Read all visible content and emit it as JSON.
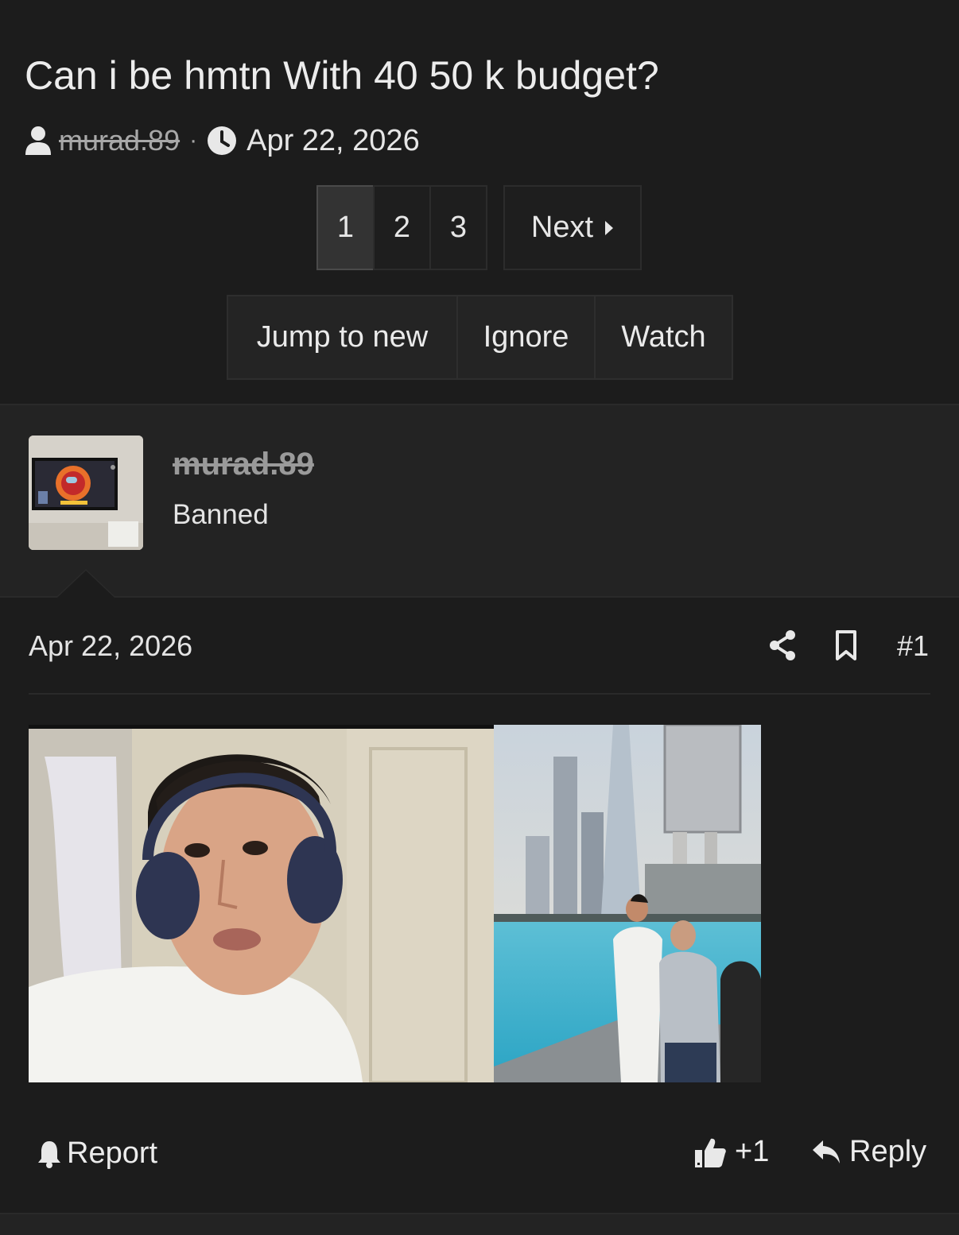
{
  "thread": {
    "title": "Can i be hmtn With 40 50 k budget?",
    "author": "murad.89",
    "separator": "·",
    "date": "Apr 22, 2026"
  },
  "pagination": {
    "pages": [
      "1",
      "2",
      "3"
    ],
    "active_page": "1",
    "next_label": "Next"
  },
  "thread_actions": {
    "jump_label": "Jump to new",
    "ignore_label": "Ignore",
    "watch_label": "Watch"
  },
  "post": {
    "username": "murad.89",
    "user_title": "Banned",
    "date": "Apr 22, 2026",
    "number": "#1",
    "report_label": "Report",
    "reaction_count": "+1",
    "reply_label": "Reply"
  },
  "icons": [
    "user-icon",
    "clock-icon",
    "caret-right-icon",
    "share-icon",
    "bookmark-icon",
    "bell-icon",
    "thumbs-up-icon",
    "reply-icon"
  ],
  "colors": {
    "background": "#1c1c1c",
    "panel": "#232323",
    "active_page": "#333333",
    "text": "#e8e8e8",
    "muted": "#9a9a9a"
  }
}
